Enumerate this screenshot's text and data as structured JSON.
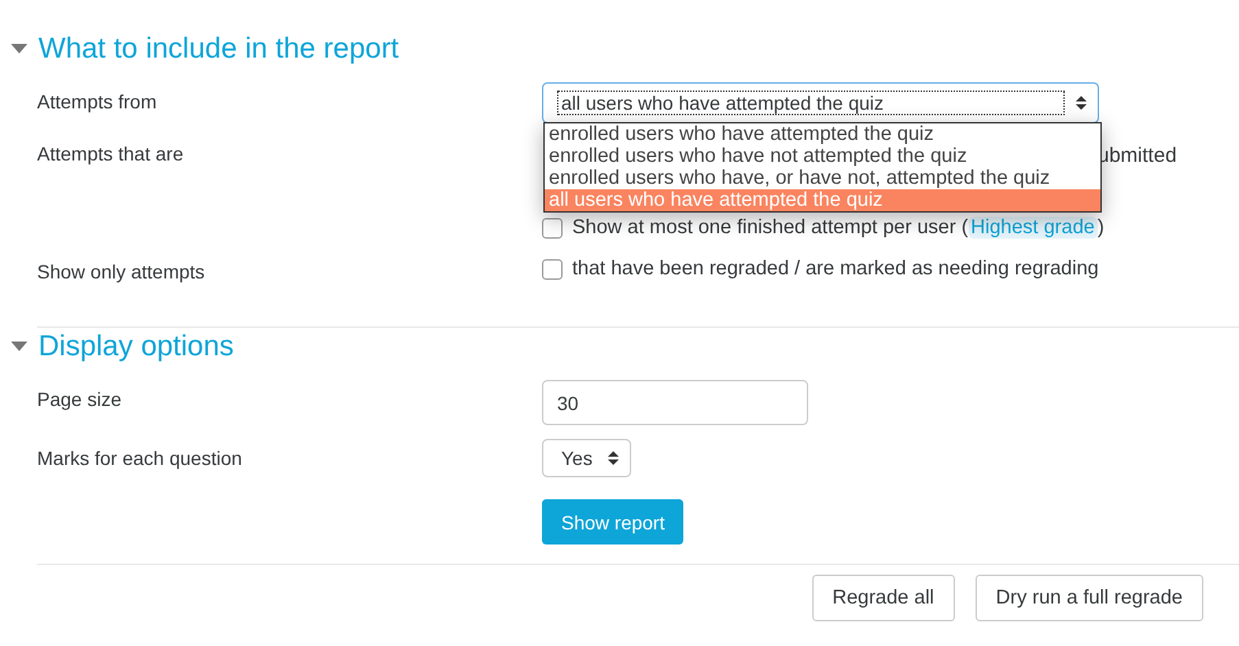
{
  "sections": [
    {
      "title": "What to include in the report",
      "expanded": true,
      "fields": [
        {
          "kind": "select",
          "label": "Attempts from",
          "value": "all users who have attempted the quiz",
          "open": true,
          "options": [
            {
              "label": "enrolled users who have attempted the quiz",
              "selected": false
            },
            {
              "label": "enrolled users who have not attempted the quiz",
              "selected": false
            },
            {
              "label": "enrolled users who have, or have not, attempted the quiz",
              "selected": false
            },
            {
              "label": "all users who have attempted the quiz",
              "selected": true
            }
          ]
        },
        {
          "kind": "checkgroup",
          "label": "Attempts that are",
          "partial_text": "ubmitted",
          "checked": false,
          "text_before": "Show at most one finished attempt per user (",
          "tag": "Highest grade",
          "text_after": ")"
        },
        {
          "kind": "checkbox",
          "label": "Show only attempts",
          "checked": false,
          "text": "that have been regraded / are marked as needing regrading"
        }
      ]
    },
    {
      "title": "Display options",
      "expanded": true,
      "fields": [
        {
          "kind": "input",
          "label": "Page size",
          "value": "30"
        },
        {
          "kind": "select",
          "label": "Marks for each question",
          "value": "Yes",
          "open": false
        },
        {
          "kind": "button",
          "text": "Show report"
        }
      ]
    }
  ],
  "footer_buttons": [
    "Regrade all",
    "Dry run a full regrade"
  ]
}
